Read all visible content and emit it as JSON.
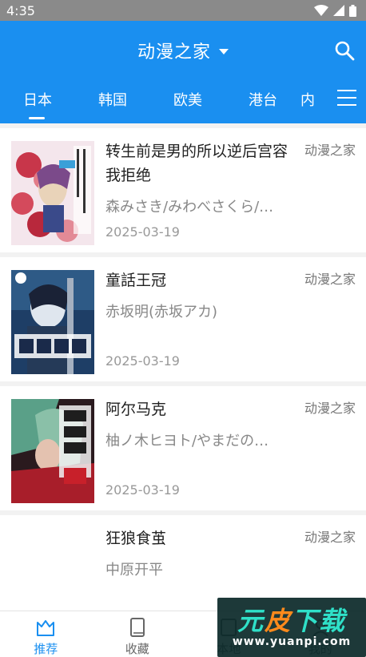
{
  "status_bar": {
    "time": "4:35"
  },
  "header": {
    "title": "动漫之家"
  },
  "tabs": [
    {
      "label": "日本",
      "active": true
    },
    {
      "label": "韩国",
      "active": false
    },
    {
      "label": "欧美",
      "active": false
    },
    {
      "label": "港台",
      "active": false
    },
    {
      "label": "内",
      "active": false
    }
  ],
  "items": [
    {
      "title": "转生前是男的所以逆后宫容我拒绝",
      "author": "森みさき/みわべさくら/…",
      "date": "2025-03-19",
      "source": "动漫之家"
    },
    {
      "title": "童話王冠",
      "author": "赤坂明(赤坂アカ)",
      "date": "2025-03-19",
      "source": "动漫之家"
    },
    {
      "title": "阿尔马克",
      "author": "柚ノ木ヒヨト/やまだの…",
      "date": "2025-03-19",
      "source": "动漫之家"
    },
    {
      "title": "狂狼食茧",
      "author": "中原开平",
      "date": "",
      "source": "动漫之家"
    }
  ],
  "bottom_nav": [
    {
      "label": "推荐",
      "icon": "crown-icon",
      "active": true
    },
    {
      "label": "收藏",
      "icon": "book-icon",
      "active": false
    },
    {
      "label": "本地",
      "icon": "download-icon",
      "active": false
    },
    {
      "label": "我的",
      "icon": "person-icon",
      "active": false
    }
  ],
  "watermark": {
    "text_a": "元",
    "text_b": "皮",
    "text_c": "下载",
    "url": "www.yuanpi.com"
  },
  "colors": {
    "primary": "#1a8ff0",
    "status_bar": "#8a8a8a"
  }
}
